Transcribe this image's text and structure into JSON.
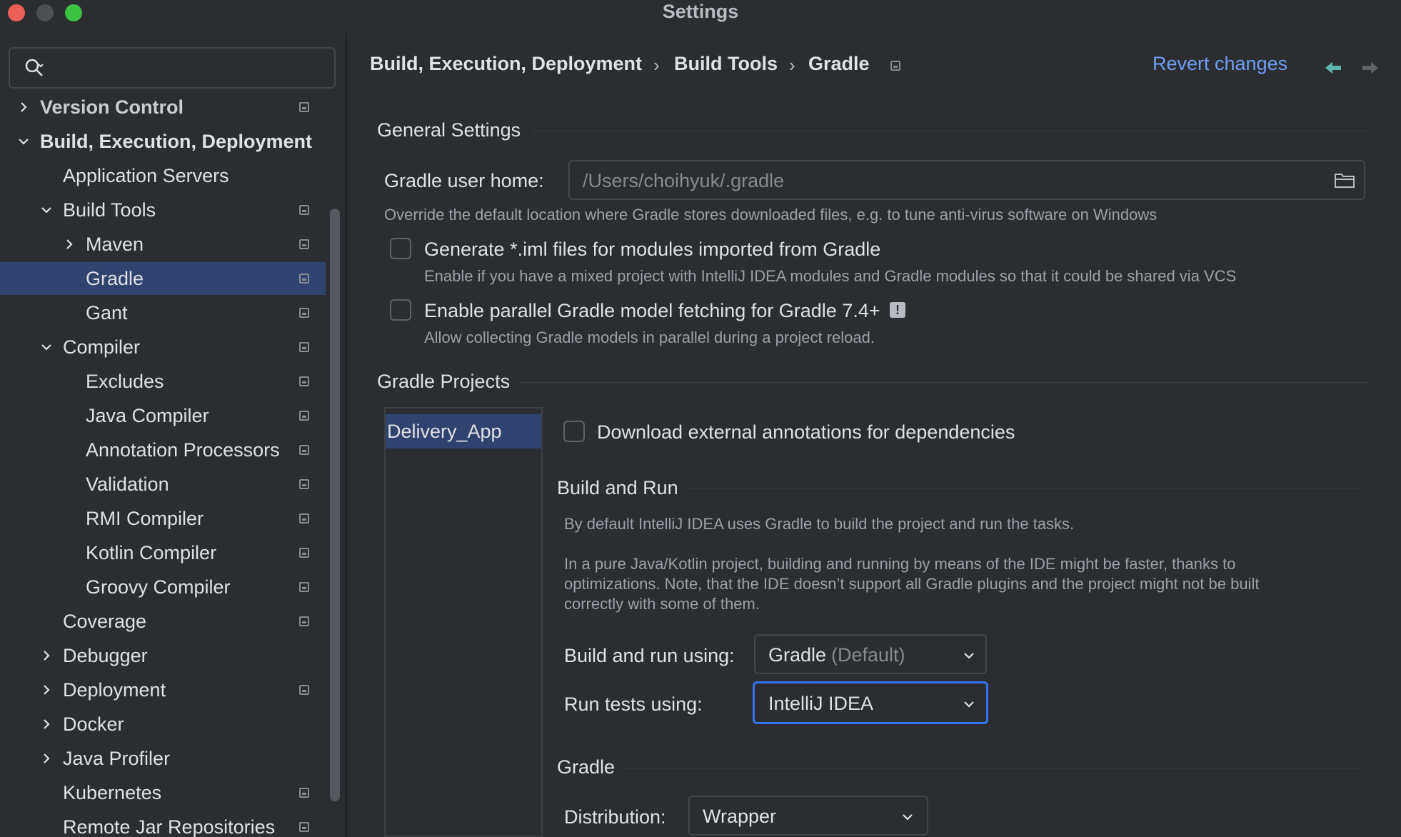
{
  "window": {
    "title": "Settings"
  },
  "sidebar": {
    "search": {
      "value": "",
      "placeholder": ""
    },
    "items": [
      {
        "label": "Version Control",
        "expanded": false
      },
      {
        "label": "Build, Execution, Deployment",
        "expanded": true
      },
      {
        "label": "Application Servers"
      },
      {
        "label": "Build Tools",
        "expanded": true
      },
      {
        "label": "Maven",
        "expanded": false
      },
      {
        "label": "Gradle",
        "selected": true
      },
      {
        "label": "Gant"
      },
      {
        "label": "Compiler",
        "expanded": true
      },
      {
        "label": "Excludes"
      },
      {
        "label": "Java Compiler"
      },
      {
        "label": "Annotation Processors"
      },
      {
        "label": "Validation"
      },
      {
        "label": "RMI Compiler"
      },
      {
        "label": "Kotlin Compiler"
      },
      {
        "label": "Groovy Compiler"
      },
      {
        "label": "Coverage"
      },
      {
        "label": "Debugger",
        "expanded": false
      },
      {
        "label": "Deployment",
        "expanded": false
      },
      {
        "label": "Docker",
        "expanded": false
      },
      {
        "label": "Java Profiler",
        "expanded": false
      },
      {
        "label": "Kubernetes"
      },
      {
        "label": "Remote Jar Repositories"
      }
    ]
  },
  "header": {
    "breadcrumb": [
      "Build, Execution, Deployment",
      "Build Tools",
      "Gradle"
    ],
    "breadcrumb_separator": "›",
    "revert_label": "Revert changes"
  },
  "general": {
    "title": "General Settings",
    "user_home_label": "Gradle user home:",
    "user_home_value": "/Users/choihyuk/.gradle",
    "user_home_hint": "Override the default location where Gradle stores downloaded files, e.g. to tune anti-virus software on Windows",
    "iml_label": "Generate *.iml files for modules imported from Gradle",
    "iml_hint": "Enable if you have a mixed project with IntelliJ IDEA modules and Gradle modules so that it could be shared via VCS",
    "iml_checked": false,
    "parallel_label": "Enable parallel Gradle model fetching for Gradle 7.4+",
    "parallel_hint": "Allow collecting Gradle models in parallel during a project reload.",
    "parallel_checked": false,
    "warn_glyph": "!"
  },
  "projects": {
    "title": "Gradle Projects",
    "list": [
      "Delivery_App"
    ],
    "download_annotations_label": "Download external annotations for dependencies",
    "download_annotations_checked": false,
    "build_run": {
      "title": "Build and Run",
      "desc1": "By default IntelliJ IDEA uses Gradle to build the project and run the tasks.",
      "desc2_line1": "In a pure Java/Kotlin project, building and running by means of the IDE might be faster, thanks to",
      "desc2_line2": "optimizations. Note, that the IDE doesn’t support all Gradle plugins and the project might not be built",
      "desc2_line3": "correctly with some of them.",
      "build_using_label": "Build and run using:",
      "build_using_value": "Gradle",
      "build_using_suffix": "(Default)",
      "tests_using_label": "Run tests using:",
      "tests_using_value": "IntelliJ IDEA"
    },
    "gradle": {
      "title": "Gradle",
      "distribution_label": "Distribution:",
      "distribution_value": "Wrapper"
    }
  },
  "colors": {
    "accent": "#3574f0",
    "selection": "#2e436e",
    "link": "#6f9ef5",
    "close": "#ec5f57",
    "minimize": "#4d4f53",
    "maximize": "#3cc343"
  }
}
